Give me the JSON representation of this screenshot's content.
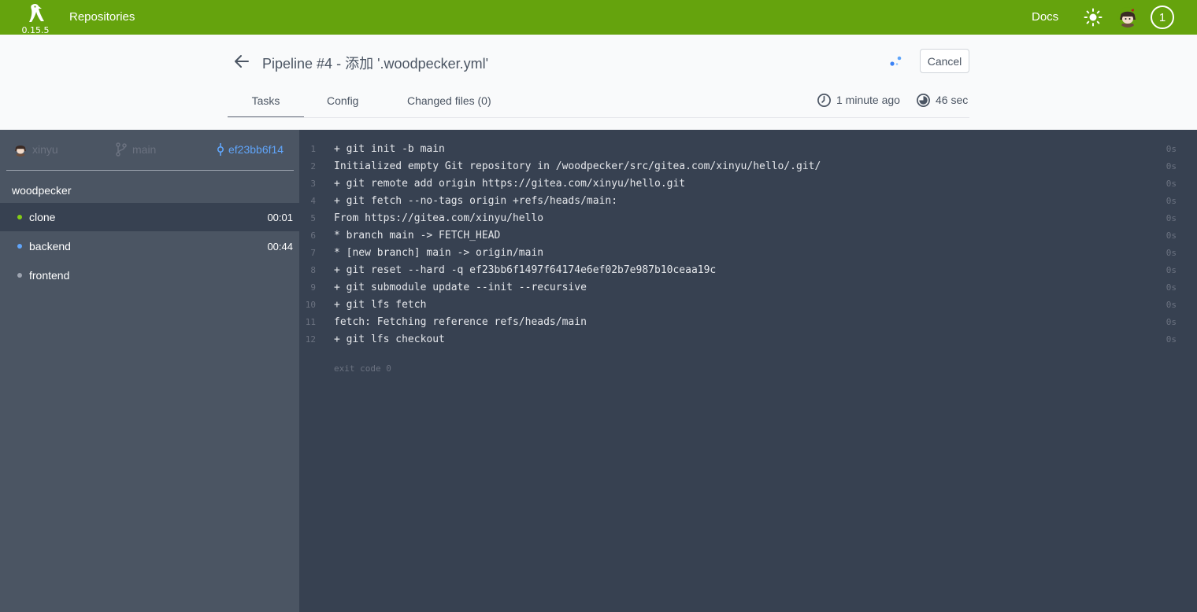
{
  "navbar": {
    "version": "0.15.5",
    "repositories_label": "Repositories",
    "docs_label": "Docs",
    "queue_count": "1"
  },
  "pipeline": {
    "title": "Pipeline #4",
    "separator": "-",
    "message": "添加 '.woodpecker.yml'",
    "cancel_label": "Cancel",
    "tabs": [
      {
        "label": "Tasks"
      },
      {
        "label": "Config"
      },
      {
        "label": "Changed files (0)"
      }
    ],
    "created": "1 minute ago",
    "duration": "46 sec"
  },
  "sidebar": {
    "author": "xinyu",
    "branch": "main",
    "commit": "ef23bb6f14",
    "workflow": "woodpecker",
    "steps": [
      {
        "name": "clone",
        "duration": "00:01",
        "status_color": "#84cc16"
      },
      {
        "name": "backend",
        "duration": "00:44",
        "status_color": "#60a5fa"
      },
      {
        "name": "frontend",
        "duration": "",
        "status_color": "#9ca3af"
      }
    ]
  },
  "log": {
    "lines": [
      {
        "num": "1",
        "text": "+ git init -b main",
        "time": "0s"
      },
      {
        "num": "2",
        "text": "Initialized empty Git repository in /woodpecker/src/gitea.com/xinyu/hello/.git/",
        "time": "0s"
      },
      {
        "num": "3",
        "text": "+ git remote add origin https://gitea.com/xinyu/hello.git",
        "time": "0s"
      },
      {
        "num": "4",
        "text": "+ git fetch --no-tags origin +refs/heads/main:",
        "time": "0s"
      },
      {
        "num": "5",
        "text": "From https://gitea.com/xinyu/hello",
        "time": "0s"
      },
      {
        "num": "6",
        "text": "* branch main -> FETCH_HEAD",
        "time": "0s"
      },
      {
        "num": "7",
        "text": "* [new branch] main -> origin/main",
        "time": "0s"
      },
      {
        "num": "8",
        "text": "+ git reset --hard -q ef23bb6f1497f64174e6ef02b7e987b10ceaa19c",
        "time": "0s"
      },
      {
        "num": "9",
        "text": "+ git submodule update --init --recursive",
        "time": "0s"
      },
      {
        "num": "10",
        "text": "+ git lfs fetch",
        "time": "0s"
      },
      {
        "num": "11",
        "text": "fetch: Fetching reference refs/heads/main",
        "time": "0s"
      },
      {
        "num": "12",
        "text": "+ git lfs checkout",
        "time": "0s"
      }
    ],
    "exit_code": "exit code 0"
  }
}
